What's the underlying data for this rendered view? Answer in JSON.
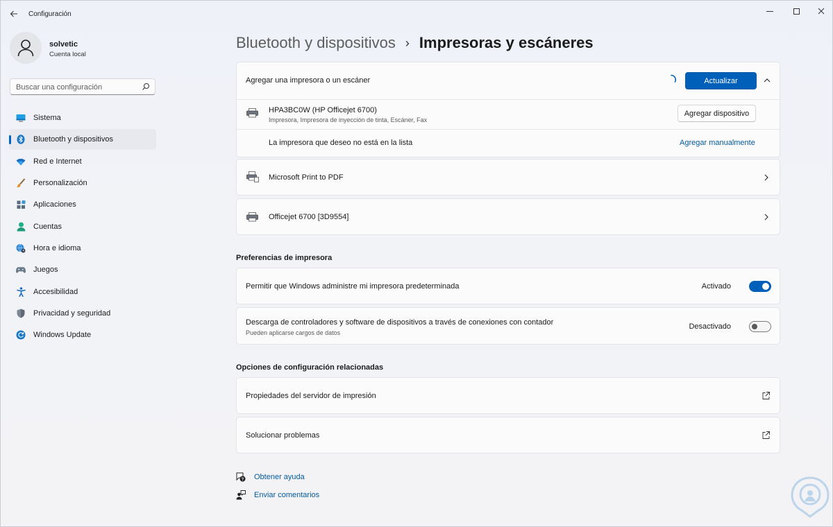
{
  "window": {
    "title": "Configuración"
  },
  "profile": {
    "name": "solvetic",
    "account_type": "Cuenta local"
  },
  "search": {
    "placeholder": "Buscar una configuración"
  },
  "nav": {
    "items": [
      {
        "label": "Sistema",
        "icon": "monitor-icon"
      },
      {
        "label": "Bluetooth y dispositivos",
        "icon": "bluetooth-icon",
        "active": true
      },
      {
        "label": "Red e Internet",
        "icon": "wifi-icon"
      },
      {
        "label": "Personalización",
        "icon": "brush-icon"
      },
      {
        "label": "Aplicaciones",
        "icon": "apps-icon"
      },
      {
        "label": "Cuentas",
        "icon": "person-icon"
      },
      {
        "label": "Hora e idioma",
        "icon": "globe-clock-icon"
      },
      {
        "label": "Juegos",
        "icon": "gamepad-icon"
      },
      {
        "label": "Accesibilidad",
        "icon": "accessibility-icon"
      },
      {
        "label": "Privacidad y seguridad",
        "icon": "shield-icon"
      },
      {
        "label": "Windows Update",
        "icon": "update-icon"
      }
    ]
  },
  "breadcrumb": {
    "parent": "Bluetooth y dispositivos",
    "separator": "›",
    "current": "Impresoras y escáneres"
  },
  "add_card": {
    "title": "Agregar una impresora o un escáner",
    "refresh_label": "Actualizar",
    "device_name": "HPA3BC0W (HP Officejet 6700)",
    "device_desc": "Impresora, Impresora de inyección de tinta, Escáner, Fax",
    "add_device_label": "Agregar dispositivo",
    "not_listed_text": "La impresora que deseo no está en la lista",
    "add_manually_label": "Agregar manualmente"
  },
  "printers": [
    {
      "name": "Microsoft Print to PDF"
    },
    {
      "name": "Officejet 6700 [3D9554]"
    }
  ],
  "preferences": {
    "title": "Preferencias de impresora",
    "default_printer": {
      "label": "Permitir que Windows administre mi impresora predeterminada",
      "state_label": "Activado",
      "on": true
    },
    "metered": {
      "label": "Descarga de controladores y software de dispositivos a través de conexiones con contador",
      "sub": "Pueden aplicarse cargos de datos",
      "state_label": "Desactivado",
      "on": false
    }
  },
  "related": {
    "title": "Opciones de configuración relacionadas",
    "items": [
      {
        "label": "Propiedades del servidor de impresión"
      },
      {
        "label": "Solucionar problemas"
      }
    ]
  },
  "footer": {
    "help_label": "Obtener ayuda",
    "feedback_label": "Enviar comentarios"
  },
  "colors": {
    "accent": "#005fb8",
    "link": "#005a9e"
  }
}
